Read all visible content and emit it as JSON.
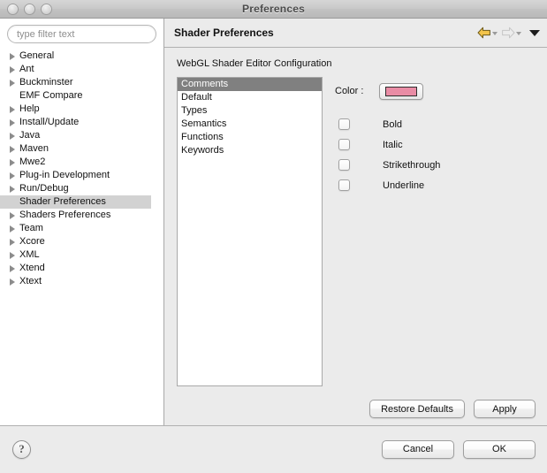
{
  "window": {
    "title": "Preferences",
    "traffic_lights": [
      "close-button",
      "minimize-button",
      "zoom-button"
    ]
  },
  "sidebar": {
    "filter": {
      "placeholder": "type filter text",
      "value": ""
    },
    "items": [
      {
        "label": "General",
        "expandable": true,
        "selected": false
      },
      {
        "label": "Ant",
        "expandable": true,
        "selected": false
      },
      {
        "label": "Buckminster",
        "expandable": true,
        "selected": false
      },
      {
        "label": "EMF Compare",
        "expandable": false,
        "selected": false
      },
      {
        "label": "Help",
        "expandable": true,
        "selected": false
      },
      {
        "label": "Install/Update",
        "expandable": true,
        "selected": false
      },
      {
        "label": "Java",
        "expandable": true,
        "selected": false
      },
      {
        "label": "Maven",
        "expandable": true,
        "selected": false
      },
      {
        "label": "Mwe2",
        "expandable": true,
        "selected": false
      },
      {
        "label": "Plug-in Development",
        "expandable": true,
        "selected": false
      },
      {
        "label": "Run/Debug",
        "expandable": true,
        "selected": false
      },
      {
        "label": "Shader Preferences",
        "expandable": false,
        "selected": true
      },
      {
        "label": "Shaders Preferences",
        "expandable": true,
        "selected": false
      },
      {
        "label": "Team",
        "expandable": true,
        "selected": false
      },
      {
        "label": "Xcore",
        "expandable": true,
        "selected": false
      },
      {
        "label": "XML",
        "expandable": true,
        "selected": false
      },
      {
        "label": "Xtend",
        "expandable": true,
        "selected": false
      },
      {
        "label": "Xtext",
        "expandable": true,
        "selected": false
      }
    ]
  },
  "page": {
    "title": "Shader Preferences",
    "toolbar": {
      "back_icon": "back-arrow-icon",
      "back_dropdown_icon": "chevron-down-icon",
      "forward_icon": "forward-arrow-icon",
      "forward_dropdown_icon": "chevron-down-icon",
      "menu_icon": "view-menu-triangle-icon",
      "back_color": "#F2C34A",
      "forward_color": "#E2E2E2"
    },
    "config_label": "WebGL Shader Editor Configuration",
    "categories": [
      {
        "label": "Comments",
        "selected": true
      },
      {
        "label": "Default",
        "selected": false
      },
      {
        "label": "Types",
        "selected": false
      },
      {
        "label": "Semantics",
        "selected": false
      },
      {
        "label": "Functions",
        "selected": false
      },
      {
        "label": "Keywords",
        "selected": false
      }
    ],
    "color": {
      "label": "Color :",
      "swatch_hex": "#E98CA5"
    },
    "style_options": [
      {
        "label": "Bold",
        "checked": false
      },
      {
        "label": "Italic",
        "checked": false
      },
      {
        "label": "Strikethrough",
        "checked": false
      },
      {
        "label": "Underline",
        "checked": false
      }
    ],
    "restore_defaults_label": "Restore Defaults",
    "apply_label": "Apply"
  },
  "footer": {
    "help_glyph": "?",
    "cancel_label": "Cancel",
    "ok_label": "OK"
  }
}
